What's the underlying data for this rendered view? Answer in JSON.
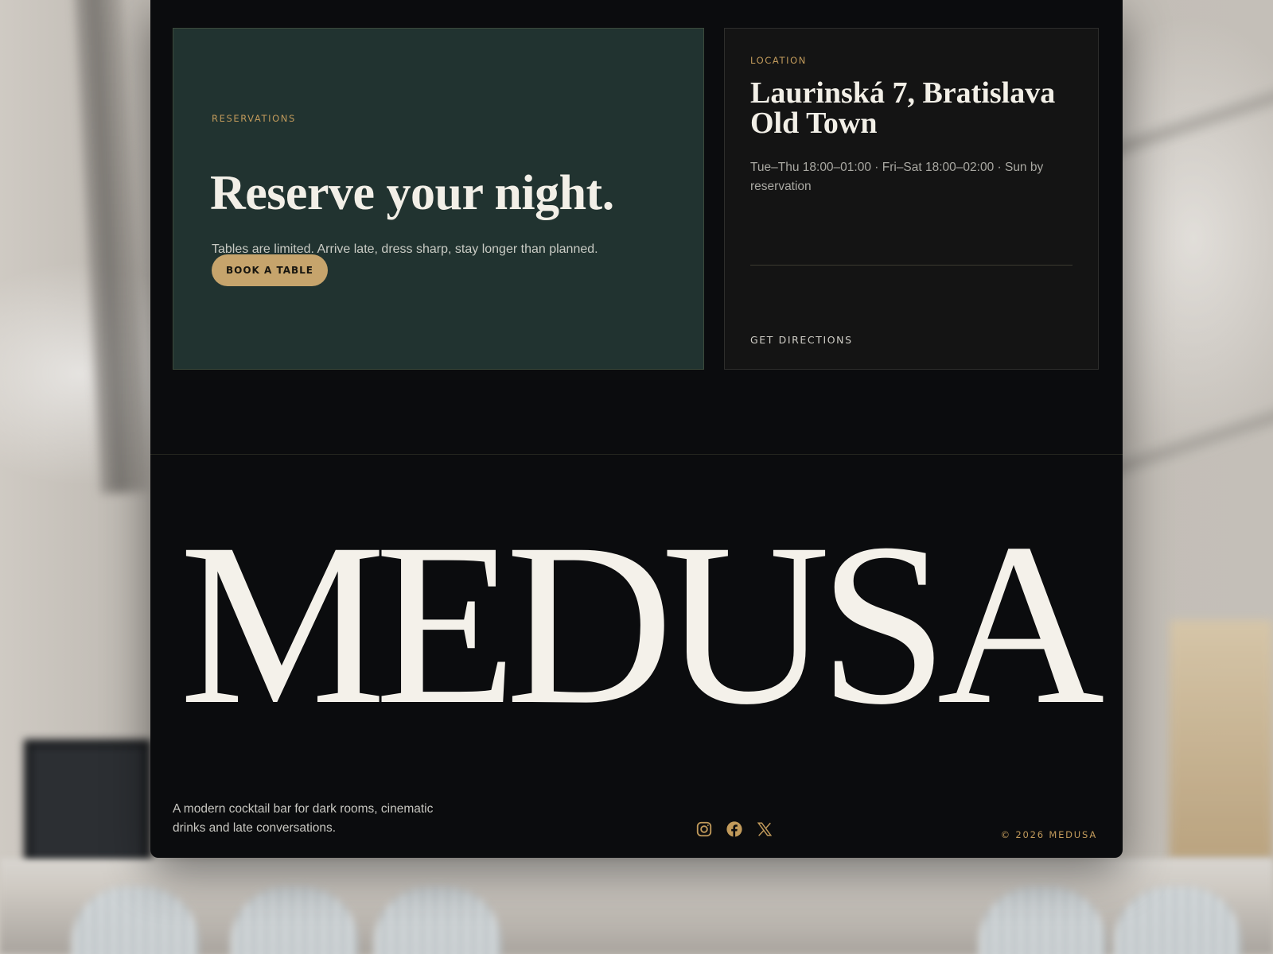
{
  "colors": {
    "page_bg": "#0b0c0e",
    "reservation_card_bg": "#213330",
    "location_card_bg": "#141414",
    "accent_gold": "#c19a5b",
    "button_bg": "#c6a46c",
    "cream_text": "#f2efe7"
  },
  "reservations": {
    "eyebrow": "RESERVATIONS",
    "title": "Reserve your night.",
    "text": "Tables are limited. Arrive late, dress sharp, stay longer than planned.",
    "button_label": "BOOK A TABLE"
  },
  "location": {
    "eyebrow": "LOCATION",
    "address_line1": "Laurinská 7, Bratislava",
    "address_line2": "Old Town",
    "hours": "Tue–Thu 18:00–01:00 · Fri–Sat 18:00–02:00 · Sun by reservation",
    "directions_label": "GET DIRECTIONS"
  },
  "footer": {
    "wordmark": "MEDUSA",
    "tagline": "A modern cocktail bar for dark rooms, cinematic drinks and late conversations.",
    "socials": [
      {
        "icon": "instagram-icon"
      },
      {
        "icon": "facebook-icon"
      },
      {
        "icon": "x-icon"
      }
    ],
    "copyright": "© 2026 MEDUSA"
  }
}
